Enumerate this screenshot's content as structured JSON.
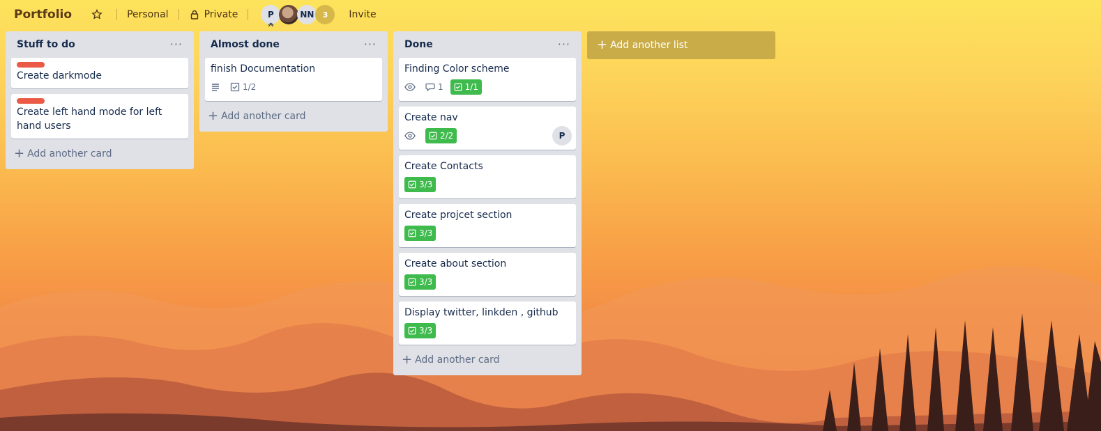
{
  "header": {
    "title": "Portfolio",
    "personal_label": "Personal",
    "private_label": "Private",
    "members": [
      {
        "initials": "P"
      },
      {
        "initials": ""
      },
      {
        "initials": "NN"
      },
      {
        "initials": "3"
      }
    ],
    "invite_label": "Invite"
  },
  "lists": [
    {
      "title": "Stuff to do",
      "add_card_label": "Add another card",
      "cards": [
        {
          "title": "Create darkmode",
          "label_color": "#eb5a46"
        },
        {
          "title": "Create left hand mode for left hand users",
          "label_color": "#eb5a46"
        }
      ]
    },
    {
      "title": "Almost done",
      "add_card_label": "Add another card",
      "cards": [
        {
          "title": "finish Documentation",
          "checklist": "1/2"
        }
      ]
    },
    {
      "title": "Done",
      "add_card_label": "Add another card",
      "cards": [
        {
          "title": "Finding Color scheme",
          "comments": "1",
          "checklist": "1/1"
        },
        {
          "title": "Create nav",
          "checklist": "2/2",
          "member": "P"
        },
        {
          "title": "Create Contacts",
          "checklist": "3/3"
        },
        {
          "title": "Create projcet section",
          "checklist": "3/3"
        },
        {
          "title": "Create about section",
          "checklist": "3/3"
        },
        {
          "title": "Display twitter, linkden , github",
          "checklist": "3/3"
        }
      ]
    }
  ],
  "add_list_label": "Add another list",
  "colors": {
    "card_label_red": "#eb5a46",
    "checklist_complete_green": "#3fba4d",
    "list_background": "#dfe1e6"
  }
}
